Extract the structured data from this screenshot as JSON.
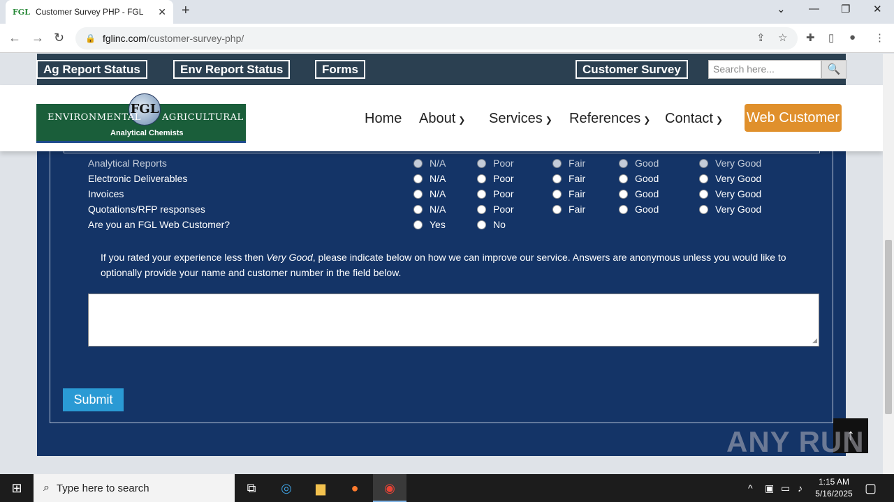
{
  "browser": {
    "tab_favicon": "FGL",
    "tab_title": "Customer Survey PHP - FGL",
    "url_host": "fglinc.com",
    "url_path": "/customer-survey-php/"
  },
  "topnav": {
    "ag_report": "Ag Report Status",
    "env_report": "Env Report Status",
    "forms": "Forms",
    "customer_survey": "Customer Survey",
    "search_placeholder": "Search here..."
  },
  "logo": {
    "circle": "FGL",
    "left": "ENVIRONMENTAL",
    "right": "AGRICULTURAL",
    "sub": "Analytical Chemists"
  },
  "mainnav": {
    "home": "Home",
    "about": "About",
    "services": "Services",
    "references": "References",
    "contact": "Contact",
    "web_customer": "Web Customer"
  },
  "survey": {
    "rating_options": [
      "N/A",
      "Poor",
      "Fair",
      "Good",
      "Very Good"
    ],
    "rows": [
      {
        "question": "Analytical Reports"
      },
      {
        "question": "Electronic Deliverables"
      },
      {
        "question": "Invoices"
      },
      {
        "question": "Quotations/RFP responses"
      }
    ],
    "web_customer_q": "Are you an FGL Web Customer?",
    "yes": "Yes",
    "no": "No",
    "note_pre": "If you rated your experience less then ",
    "note_em": "Very Good",
    "note_post": ", please indicate below on how we can improve our service. Answers are anonymous unless you would like to optionally provide your name and customer number in the field below.",
    "submit": "Submit"
  },
  "watermark": "ANY RUN",
  "taskbar": {
    "search_placeholder": "Type here to search",
    "time": "1:15 AM",
    "date": "5/16/2025"
  },
  "colors": {
    "panel": "#143467",
    "topnav": "#2b4051",
    "web_customer_button": "#e0902c",
    "submit_button": "#2a9ad4"
  }
}
